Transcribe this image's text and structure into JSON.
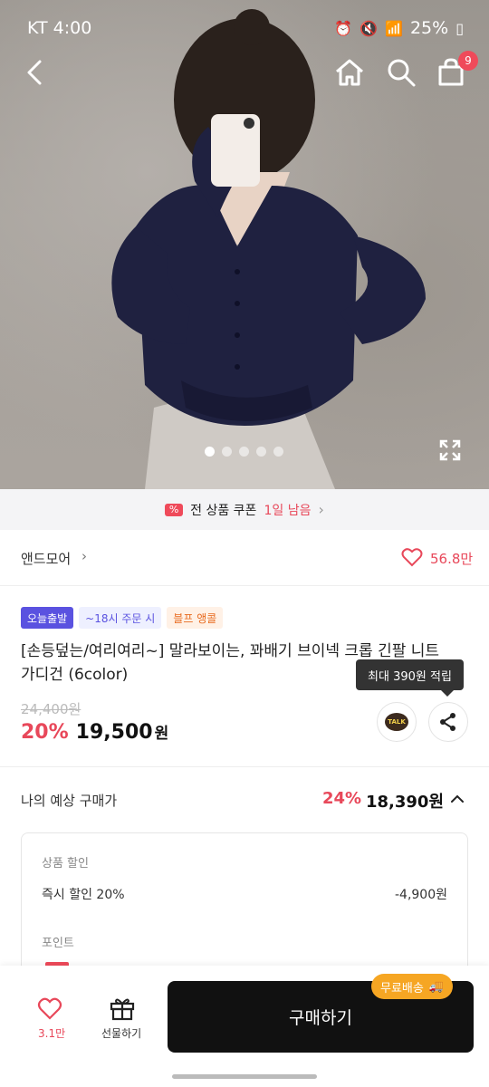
{
  "status_bar": {
    "carrier_time": "KT 4:00",
    "battery": "25%"
  },
  "header": {
    "cart_count": "9"
  },
  "gallery": {
    "total_images": 5,
    "active_index": 1
  },
  "coupon_bar": {
    "text": "전 상품 쿠폰",
    "highlight": "1일 남음"
  },
  "store": {
    "name": "앤드모어",
    "likes": "56.8만"
  },
  "badges": [
    "오늘출발",
    "~18시 주문 시",
    "블프 앵콜"
  ],
  "product": {
    "title": "[손등덮는/여리여리~] 말라보이는, 꽈배기 브이넥 크롭 긴팔 니트가디건 (6color)",
    "original_price": "24,400원",
    "discount": "20%",
    "price": "19,500",
    "price_unit": "원",
    "points_tooltip": "최대 390원 적립"
  },
  "expected_price": {
    "label": "나의 예상 구매가",
    "discount": "24%",
    "price": "18,390원"
  },
  "detail": {
    "section_discount": "상품 할인",
    "instant_label": "즉시 할인 20%",
    "instant_value": "-4,900원",
    "section_points": "포인트"
  },
  "bottom_bar": {
    "wish_count": "3.1만",
    "gift_label": "선물하기",
    "buy_label": "구매하기",
    "free_shipping": "무료배송"
  }
}
